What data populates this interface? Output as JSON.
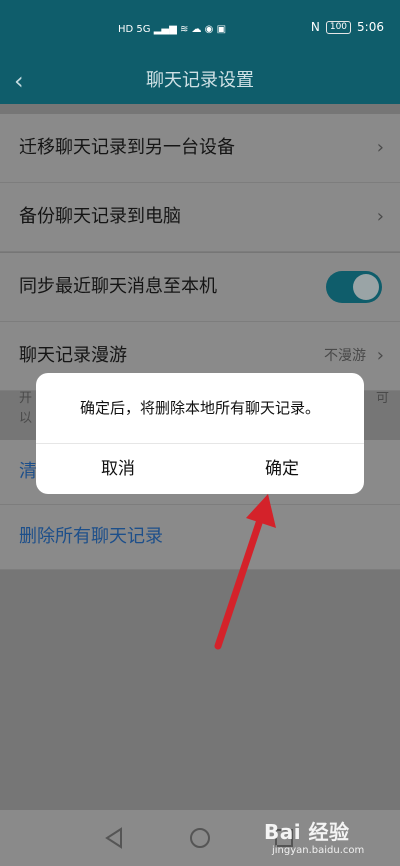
{
  "status": {
    "left_icons": "HD 5G ▂▄▆ ≋ ☁ ◉ ▣",
    "nfc": "N",
    "battery": "100",
    "time": "5:06"
  },
  "header": {
    "title": "聊天记录设置",
    "back_icon": "back-arrow-icon"
  },
  "section1": {
    "items": [
      {
        "label": "迁移聊天记录到另一台设备"
      },
      {
        "label": "备份聊天记录到电脑"
      }
    ]
  },
  "section2": {
    "sync_label": "同步最近聊天消息至本机",
    "sync_on": true,
    "roam_label": "聊天记录漫游",
    "roam_value": "不漫游"
  },
  "hint": {
    "line1": "开",
    "line1_end": "可",
    "line2": "以"
  },
  "section3": {
    "clear_label": "清",
    "delete_label": "删除所有聊天记录"
  },
  "dialog": {
    "message": "确定后，将删除本地所有聊天记录。",
    "cancel": "取消",
    "confirm": "确定"
  },
  "annotation": {
    "color": "#d4222a"
  },
  "watermark": {
    "text": "Bai 经验",
    "sub": "jingyan.baidu.com"
  }
}
